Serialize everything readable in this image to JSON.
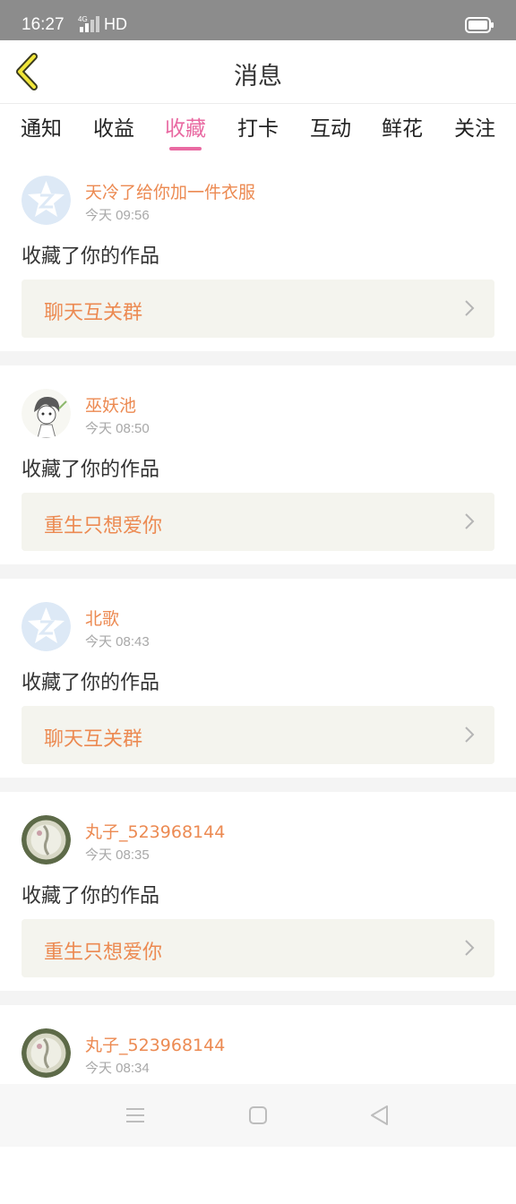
{
  "status_bar": {
    "time": "16:27",
    "network": "HD"
  },
  "header": {
    "title": "消息"
  },
  "tabs": [
    {
      "label": "通知"
    },
    {
      "label": "收益"
    },
    {
      "label": "收藏",
      "active": true
    },
    {
      "label": "打卡"
    },
    {
      "label": "互动"
    },
    {
      "label": "鲜花"
    },
    {
      "label": "关注"
    }
  ],
  "feed": [
    {
      "user": "天冷了给你加一件衣服",
      "time": "今天 09:56",
      "action": "收藏了你的作品",
      "work": "聊天互关群",
      "avatar": "default-avatar"
    },
    {
      "user": "巫妖池",
      "time": "今天 08:50",
      "action": "收藏了你的作品",
      "work": "重生只想爱你",
      "avatar": "sketch-avatar"
    },
    {
      "user": "北歌",
      "time": "今天 08:43",
      "action": "收藏了你的作品",
      "work": "聊天互关群",
      "avatar": "default-avatar"
    },
    {
      "user": "丸子_523968144",
      "time": "今天 08:35",
      "action": "收藏了你的作品",
      "work": "重生只想爱你",
      "avatar": "photo-avatar"
    },
    {
      "user": "丸子_523968144",
      "time": "今天 08:34",
      "avatar": "photo-avatar"
    }
  ],
  "colors": {
    "accent": "#e96aa2",
    "username": "#ec8a52",
    "status_bar": "#8c8c8c",
    "card_bg": "#f4f4ee"
  }
}
